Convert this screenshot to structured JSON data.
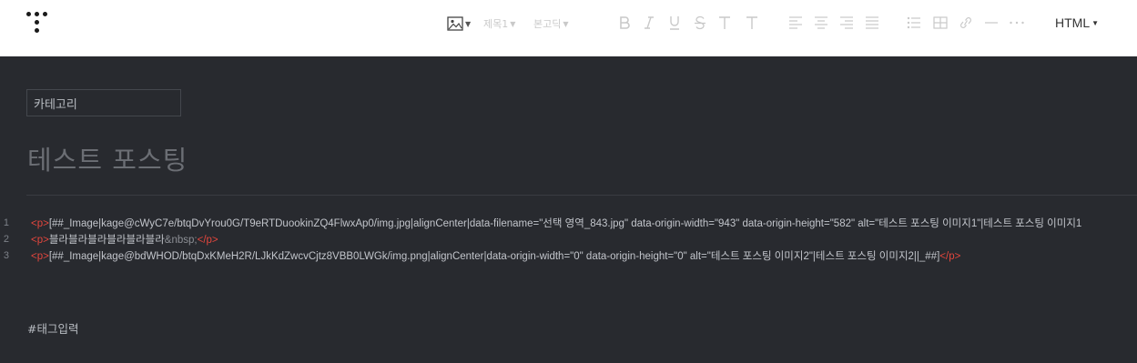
{
  "toolbar": {
    "heading_label": "제목1",
    "font_label": "본고딕",
    "mode_label": "HTML",
    "format_icons": [
      "bold-icon",
      "italic-icon",
      "underline-icon",
      "strikethrough-icon",
      "text-color-icon",
      "text-background-icon"
    ],
    "align_icons": [
      "align-left-icon",
      "align-center-icon",
      "align-right-icon",
      "align-justify-icon"
    ],
    "insert_icons": [
      "bulleted-list-icon",
      "table-icon",
      "link-icon",
      "horizontal-rule-icon",
      "more-icon"
    ]
  },
  "editor": {
    "category_placeholder": "카테고리",
    "post_title": "테스트 포스팅",
    "code_lines": [
      {
        "number": "1",
        "open_tag": "<p>",
        "content": "[##_Image|kage@cWyC7e/btqDvYrou0G/T9eRTDuookinZQ4FlwxAp0/img.jpg|alignCenter|data-filename=\"선택 영역_843.jpg\" data-origin-width=\"943\" data-origin-height=\"582\" alt=\"테스트 포스팅 이미지1\"|테스트 포스팅 이미지1",
        "entity": "",
        "close_tag": ""
      },
      {
        "number": "2",
        "open_tag": "<p>",
        "content": "블라블라블라블라블라블라",
        "entity": "&nbsp;",
        "close_tag": "</p>"
      },
      {
        "number": "3",
        "open_tag": "<p>",
        "content": "[##_Image|kage@bdWHOD/btqDxKMeH2R/LJkKdZwcvCjtz8VBB0LWGk/img.png|alignCenter|data-origin-width=\"0\" data-origin-height=\"0\" alt=\"테스트 포스팅 이미지2\"|테스트 포스팅 이미지2||_##]",
        "entity": "",
        "close_tag": "</p>"
      }
    ],
    "tag_input": "#태그입력"
  },
  "colors": {
    "editor_bg": "#282a2f",
    "toolbar_bg": "#ffffff",
    "html_tag": "#e2463d",
    "code_text": "#c2c5cb"
  }
}
